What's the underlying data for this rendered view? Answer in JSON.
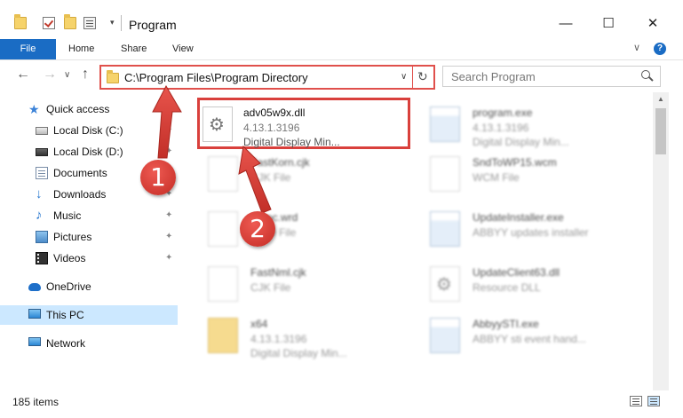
{
  "window": {
    "title": "Program",
    "minimize": "—",
    "maximize": "☐",
    "close": "✕",
    "qa_dropdown": "▾"
  },
  "ribbon": {
    "tabs": [
      "File",
      "Home",
      "Share",
      "View"
    ],
    "expand": "∨",
    "help": "?"
  },
  "address": {
    "path": "C:\\Program Files\\Program Directory",
    "dropdown": "∨",
    "refresh": "↻",
    "back": "←",
    "forward": "→",
    "recent": "∨",
    "up": "↑"
  },
  "search": {
    "placeholder": "Search Program"
  },
  "sidebar": {
    "items": [
      {
        "label": "Quick access",
        "icon": "star-icon"
      },
      {
        "label": "Local Disk (C:)",
        "icon": "drive-icon",
        "pinned": true
      },
      {
        "label": "Local Disk (D:)",
        "icon": "drive-icon",
        "pinned": true
      },
      {
        "label": "Documents",
        "icon": "documents-icon",
        "pinned": true
      },
      {
        "label": "Downloads",
        "icon": "download-icon",
        "pinned": true
      },
      {
        "label": "Music",
        "icon": "music-icon",
        "pinned": true
      },
      {
        "label": "Pictures",
        "icon": "pictures-icon",
        "pinned": true
      },
      {
        "label": "Videos",
        "icon": "videos-icon",
        "pinned": true
      },
      {
        "label": "OneDrive",
        "icon": "cloud-icon"
      },
      {
        "label": "This PC",
        "icon": "computer-icon",
        "selected": true
      },
      {
        "label": "Network",
        "icon": "network-icon"
      }
    ],
    "pin_glyph": "📌"
  },
  "files": [
    {
      "name": "adv05w9x.dll",
      "line2": "4.13.1.3196",
      "line3": "Digital Display Min...",
      "icon": "gear-file-icon",
      "selected": true
    },
    {
      "name": "program.exe",
      "line2": "4.13.1.3196",
      "line3": "Digital Display Min...",
      "icon": "app-file-icon"
    },
    {
      "name": "FastKorn.cjk",
      "line2": "CJK File",
      "line3": "",
      "icon": "blank-file-icon"
    },
    {
      "name": "SndToWP15.wcm",
      "line2": "WCM File",
      "line3": "",
      "icon": "blank-file-icon"
    },
    {
      "name": "Autoc.wrd",
      "line2": "WRD File",
      "line3": "",
      "icon": "blank-file-icon"
    },
    {
      "name": "UpdateInstaller.exe",
      "line2": "ABBYY updates installer",
      "line3": "",
      "icon": "app-file-icon"
    },
    {
      "name": "FastNml.cjk",
      "line2": "CJK File",
      "line3": "",
      "icon": "blank-file-icon"
    },
    {
      "name": "UpdateClient63.dll",
      "line2": "Resource DLL",
      "line3": "",
      "icon": "gear-file-icon"
    },
    {
      "name": "x64",
      "line2": "4.13.1.3196",
      "line3": "Digital Display Min...",
      "icon": "folder-icon"
    },
    {
      "name": "AbbyySTI.exe",
      "line2": "ABBYY sti event hand...",
      "line3": "",
      "icon": "app-file-icon"
    }
  ],
  "status": {
    "items": "185 items"
  },
  "annotations": [
    "1",
    "2"
  ],
  "colors": {
    "accent": "#1a6cc4",
    "highlight": "#d9403c",
    "selection": "#cce8ff"
  }
}
